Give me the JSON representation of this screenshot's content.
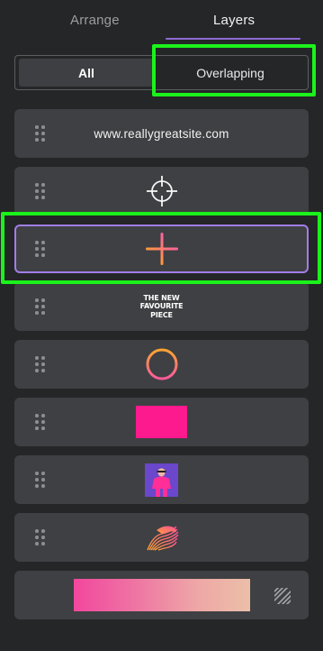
{
  "tabs": {
    "arrange": "Arrange",
    "layers": "Layers",
    "active": "Layers"
  },
  "filter": {
    "all": "All",
    "overlapping": "Overlapping",
    "selected": "All"
  },
  "layers": [
    {
      "type": "text",
      "text": "www.reallygreatsite.com"
    },
    {
      "type": "graphic",
      "icon": "crosshair-icon"
    },
    {
      "type": "graphic",
      "icon": "plus-gradient-icon",
      "selected": true
    },
    {
      "type": "text",
      "text_lines": [
        "THE NEW",
        "FAVOURITE",
        "PIECE"
      ]
    },
    {
      "type": "graphic",
      "icon": "gradient-ring-icon"
    },
    {
      "type": "shape",
      "icon": "pink-rectangle",
      "color": "#fd1a8e"
    },
    {
      "type": "image",
      "icon": "model-photo-thumbnail"
    },
    {
      "type": "graphic",
      "icon": "gradient-wave-icon"
    },
    {
      "type": "background",
      "icon": "gradient-background",
      "colors": [
        "#f2479e",
        "#ecbfa8"
      ]
    }
  ],
  "colors": {
    "panel_bg": "#252627",
    "row_bg": "#3f4043",
    "accent": "#8f6bd4",
    "annotation": "#1bf21b"
  }
}
